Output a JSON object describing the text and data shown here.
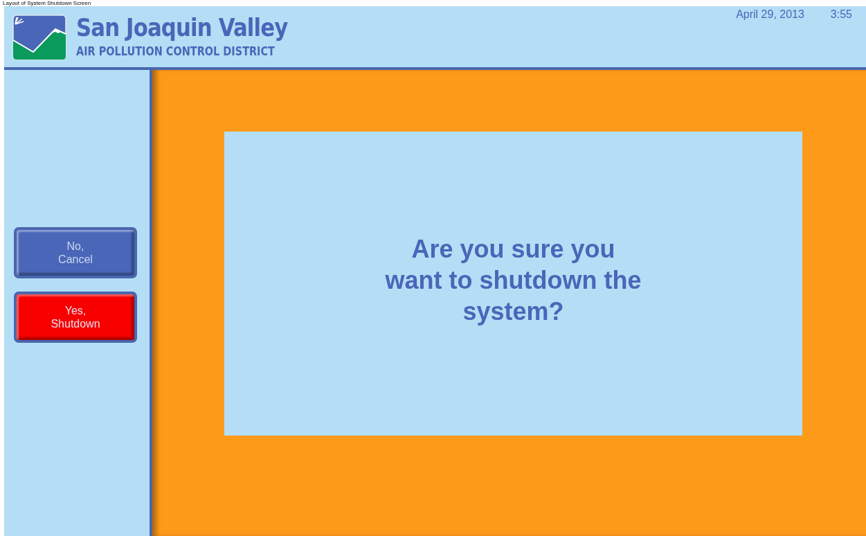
{
  "caption": "Layout of System Shutdown Screen",
  "header": {
    "title": "San Joaquin Valley",
    "subtitle": "AIR POLLUTION CONTROL DISTRICT",
    "date": "April 29, 2013",
    "time": "3:55"
  },
  "sidebar": {
    "buttons": [
      {
        "label": "No,\nCancel",
        "kind": "cancel"
      },
      {
        "label": "Yes,\nShutdown",
        "kind": "confirm"
      }
    ]
  },
  "dialog": {
    "message": "Are you sure you\nwant to shutdown the\nsystem?"
  }
}
